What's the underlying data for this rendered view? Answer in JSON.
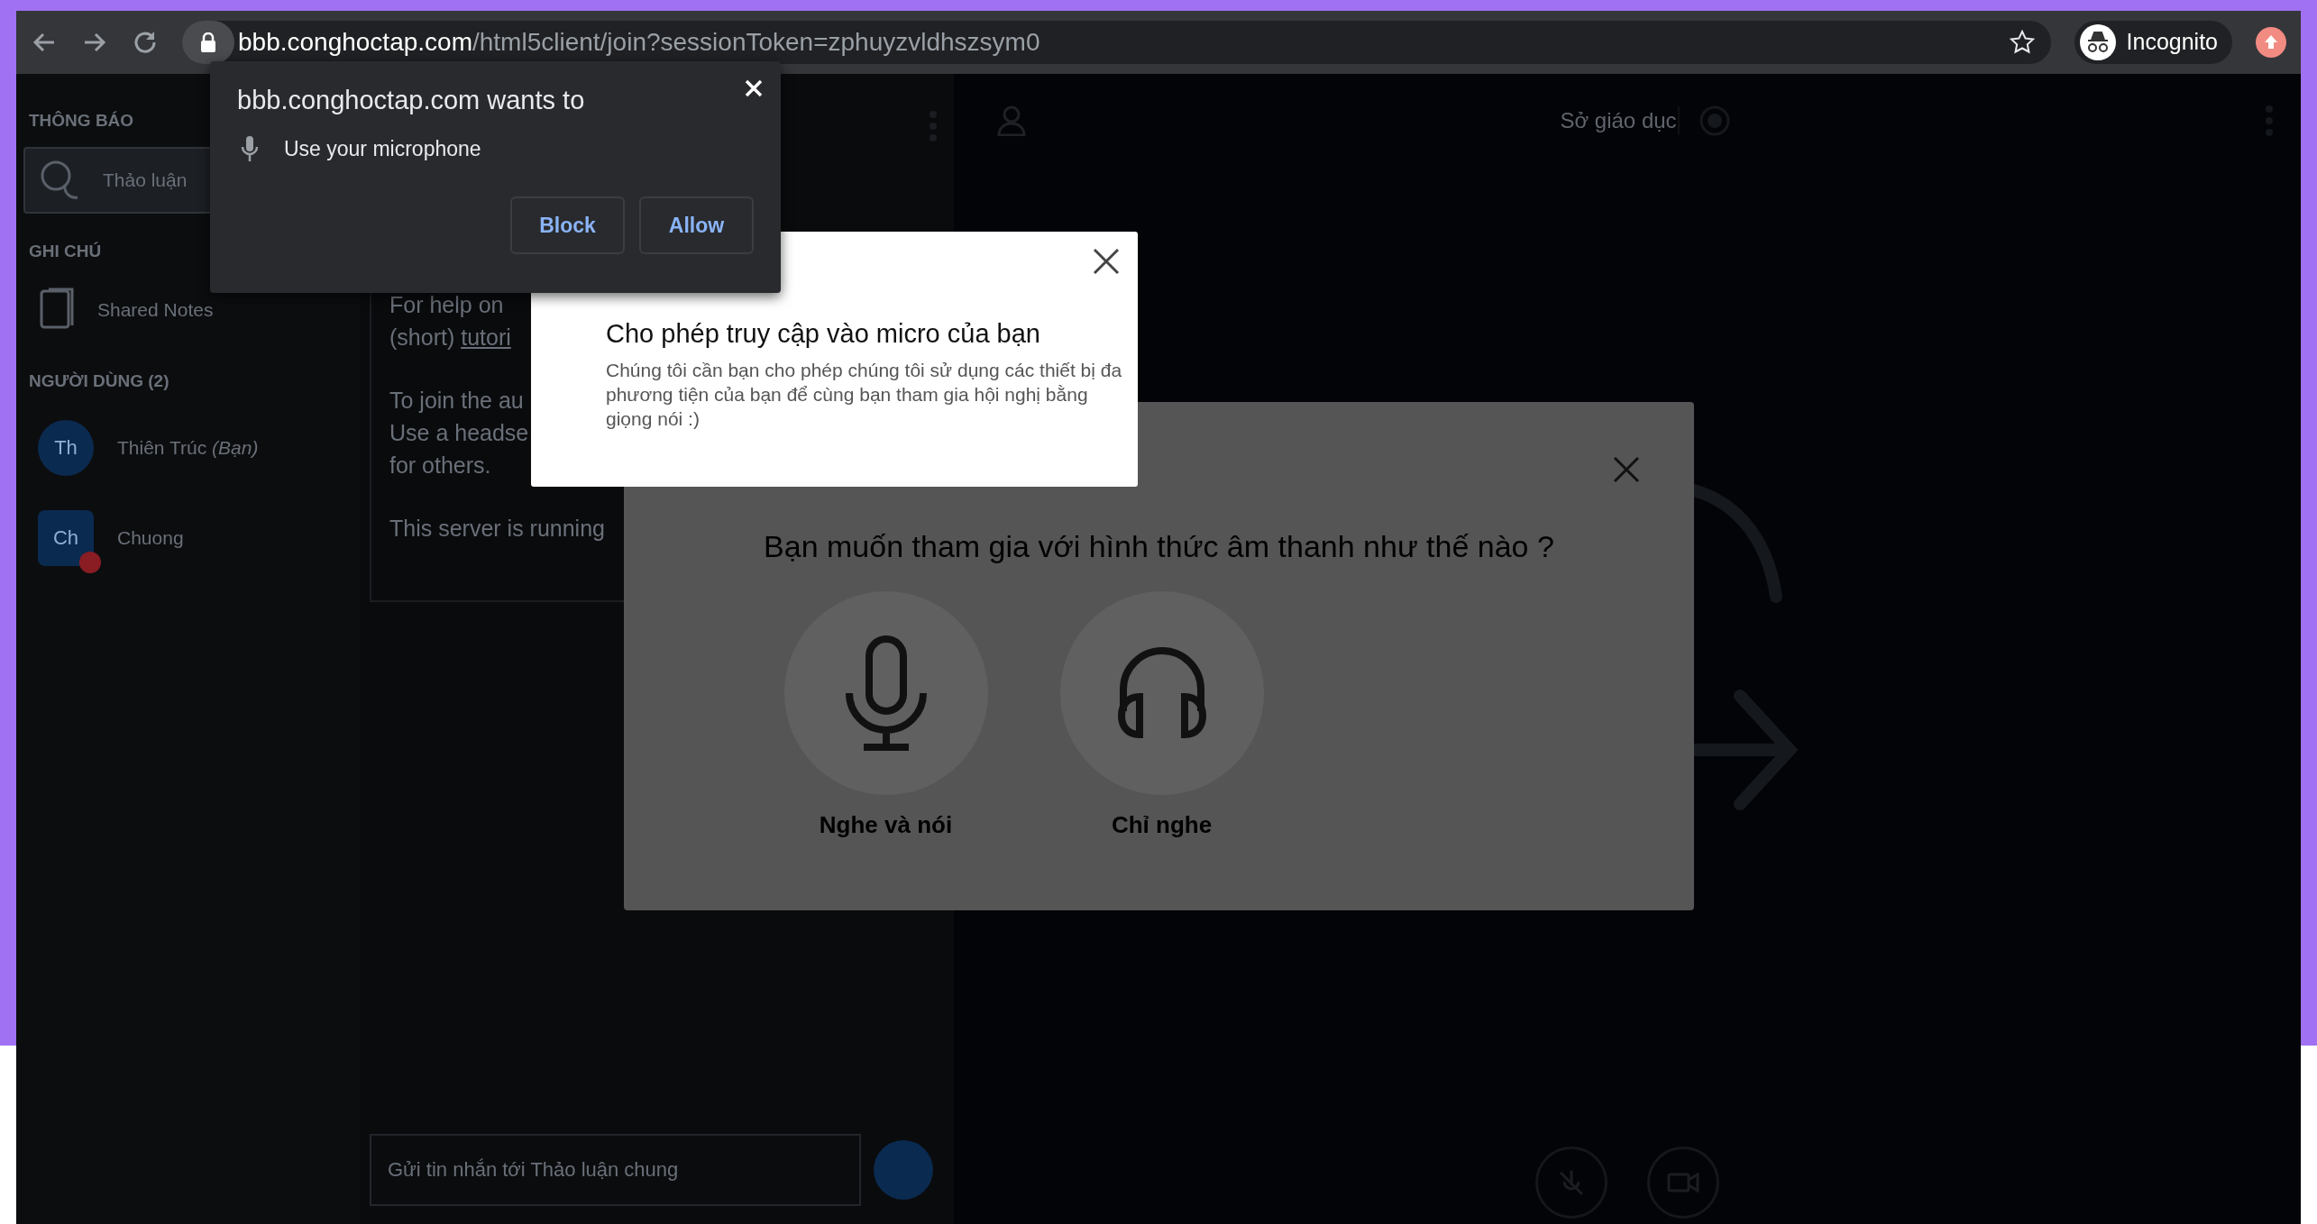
{
  "browser": {
    "url_host": "bbb.conghoctap.com",
    "url_path": "/html5client/join?sessionToken=zphuyzvldhszsym0",
    "profile": "Incognito"
  },
  "permission_prompt": {
    "title": "bbb.conghoctap.com wants to",
    "request": "Use your microphone",
    "buttons": [
      "Block",
      "Allow"
    ]
  },
  "sidebar": {
    "messages_heading": "THÔNG BÁO",
    "messages": [
      {
        "label": "Thảo luận",
        "selected": true
      }
    ],
    "notes_heading": "GHI CHÚ",
    "notes": [
      {
        "label": "Shared Notes"
      }
    ],
    "users_heading": "NGƯỜI DÙNG (2)",
    "users": [
      {
        "initials": "Th",
        "name": "Thiên Trúc *(Bạn)*",
        "kind": "viewer",
        "muted": false
      },
      {
        "initials": "Ch",
        "name": "Chuong",
        "kind": "moderator",
        "muted": true
      }
    ]
  },
  "chat": {
    "paragraphs": [
      {
        "lines": [
          {
            "text": "For help on"
          },
          {
            "text": "(short) ",
            "link": "tutori"
          }
        ]
      },
      {
        "lines": [
          {
            "text": "To join the au"
          },
          {
            "text": "Use a headse"
          },
          {
            "text": "for others."
          }
        ]
      },
      {
        "lines": [
          {
            "text": "This server is running"
          }
        ]
      }
    ],
    "placeholder": "Gửi tin nhắn tới Thảo luận chung"
  },
  "main": {
    "title": "Sở giáo dục"
  },
  "mic_modal": {
    "title": "Cho phép truy cập vào micro của bạn",
    "body": "Chúng tôi cần bạn cho phép chúng tôi sử dụng các thiết bị đa phương tiện của bạn để cùng bạn tham gia hội nghị bằng giọng nói :)"
  },
  "audio_modal": {
    "question": "Bạn muốn tham gia với hình thức âm thanh như thế nào ?",
    "options": [
      {
        "kind": "microphone",
        "label": "Nghe và nói"
      },
      {
        "kind": "listen",
        "label": "Chỉ nghe"
      }
    ]
  }
}
